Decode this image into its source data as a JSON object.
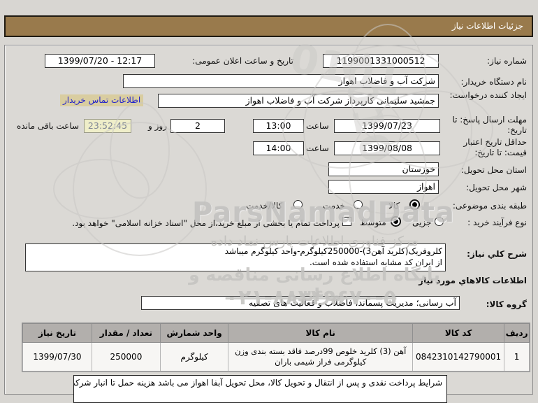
{
  "colors": {
    "titlebar_bg": "#997a4c",
    "link_blue": "#2222cc",
    "countdown_bg": "#efeec9",
    "table_header_bg": "#b2afac"
  },
  "header": {
    "title": "جزئیات اطلاعات نیاز"
  },
  "form": {
    "need_number": {
      "label": "شماره نیاز:",
      "value": "1199001331000512"
    },
    "announce": {
      "label": "تاریخ و ساعت اعلان عمومی:",
      "value": "1399/07/20 - 12:17"
    },
    "buyer_org": {
      "label": "نام دستگاه خریدار:",
      "value": "شرکت آب و فاضلاب اهواز"
    },
    "creator": {
      "label": "ایجاد کننده درخواست:",
      "value": "جمشید سلیمانی کارپرداز شرکت آب و فاضلاب اهواز",
      "contact_link": "اطلاعات تماس خریدار"
    },
    "deadline": {
      "label": "مهلت ارسال پاسخ: تا تاریخ:",
      "date": "1399/07/23",
      "hour_label": "ساعت",
      "time": "13:00",
      "days": "2",
      "days_label": "روز و",
      "countdown": "23:52:45",
      "remaining_label": "ساعت باقی مانده"
    },
    "validity": {
      "label": "حداقل تاریخ اعتبار قیمت: تا تاریخ:",
      "date": "1399/08/08",
      "hour_label": "ساعت",
      "time": "14:00"
    },
    "province": {
      "label": "استان محل تحویل:",
      "value": "خوزستان"
    },
    "city": {
      "label": "شهر محل تحویل:",
      "value": "اهواز"
    },
    "classification": {
      "label": "طبقه بندی موضوعی:",
      "options": [
        {
          "label": "کالا",
          "selected": true
        },
        {
          "label": "خدمت",
          "selected": false
        },
        {
          "label": "کالا/خدمت",
          "selected": false
        }
      ]
    },
    "process": {
      "label": "نوع فرآیند خرید :",
      "options": [
        {
          "label": "جزیی",
          "selected": false
        },
        {
          "label": "متوسط",
          "selected": true
        }
      ],
      "checkbox_checked": false,
      "checkbox_label": "پرداخت تمام یا بخشی از مبلغ خرید،از محل \"اسناد خزانه اسلامی\" خواهد بود."
    },
    "description": {
      "label": "شرح کلي نیاز:",
      "line1": "کلروفریک(کلرید آهن3)-250000کیلوگرم-واحد کیلوگرم میباشد",
      "line2": "از ایران کد مشابه استفاده شده است."
    },
    "goods_section_title": "اطلاعات کالاهاي مورد نیاز",
    "goods_group": {
      "label": "گروه کالا:",
      "value": "آب رسانی؛ مدیریت پسماند، فاضلاب و فعالیت های تصفیه"
    }
  },
  "table": {
    "headers": {
      "row_no": "ردیف",
      "item_code": "کد کالا",
      "item_name": "نام کالا",
      "unit": "واحد شمارش",
      "quantity": "تعداد / مقدار",
      "need_date": "تاریخ نیاز"
    },
    "rows": [
      {
        "row_no": "1",
        "item_code": "0842310142790001",
        "item_name": "آهن (3) کلرید خلوص 99درصد فاقد بسته بندی وزن کیلوگرمی فراز شیمی باران",
        "unit": "کیلوگرم",
        "quantity": "250000",
        "need_date": "1399/07/30"
      }
    ]
  },
  "bottom_note": "شرایط پرداخت نقدی و پس از انتقال و تحویل کالا، محل تحویل آبفا اهواز می باشد هزینه حمل تا انبار شرکت",
  "watermark": {
    "latin": "ParsNamadData",
    "fa_line1": "مرکز فناوری اطلاعات پارس نماد داده",
    "fa_line2": "پایگاه اطلاع رسانی مناقصه و مزایده",
    "phone": "۰۲۱-۸۸۳۴۹۶۷۰-۵"
  }
}
